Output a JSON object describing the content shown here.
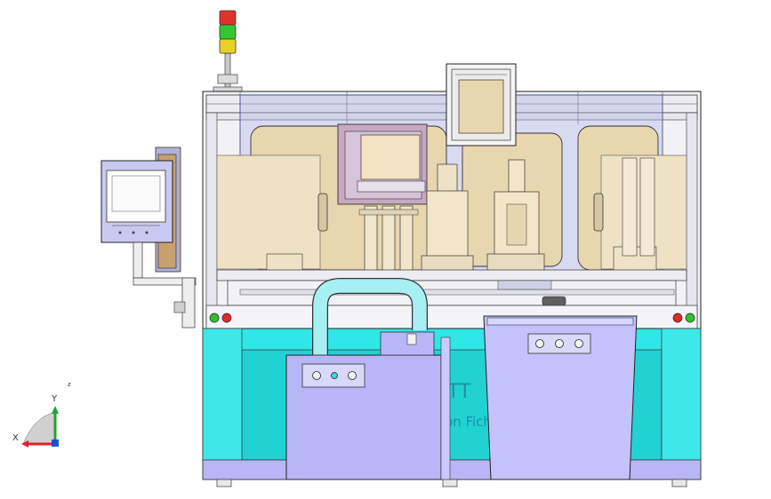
{
  "viewport": {
    "background": "#ffffff",
    "coord_label": "z"
  },
  "triad": {
    "x_label": "X",
    "y_label": "Y",
    "x_color": "#e0202a",
    "y_color": "#1fa52c",
    "z_color": "#2050d0"
  },
  "signal_tower": {
    "lights": [
      "red",
      "green",
      "yellow"
    ],
    "colors": [
      "#e0322a",
      "#32c832",
      "#e8d228"
    ]
  },
  "cabinet": {
    "body_color": "#30e6e6",
    "panel_color": "#b8b6f6",
    "stand_color": "#c4c2fa"
  },
  "machine_text": {
    "brand_fragment": "TT",
    "name_fragment": "on Fichi"
  },
  "pilot_lamps": {
    "left": [
      "#2fbf2f",
      "#e02a2a"
    ],
    "right": [
      "#e02a2a",
      "#2fbf2f"
    ]
  }
}
